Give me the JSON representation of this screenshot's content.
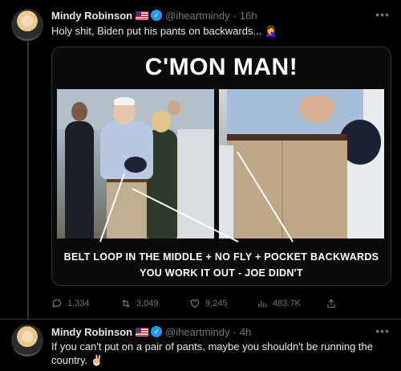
{
  "tweets": [
    {
      "author_name": "Mindy Robinson",
      "handle": "@iheartmindy",
      "time": "16h",
      "text": "Holy shit, Biden put his pants on backwards... ",
      "emoji": "🤦‍♀️",
      "media": {
        "headline": "C'MON MAN!",
        "caption_line1": "BELT LOOP IN THE MIDDLE + NO FLY + POCKET BACKWARDS",
        "caption_line2": "YOU WORK IT OUT - JOE DIDN'T"
      },
      "actions": {
        "replies": "1,334",
        "retweets": "3,049",
        "likes": "9,245",
        "views": "483.7K"
      }
    },
    {
      "author_name": "Mindy Robinson",
      "handle": "@iheartmindy",
      "time": "4h",
      "text": "If you can't put on a pair of pants, maybe you shouldn't be running the country. ",
      "emoji": "✌🏻"
    }
  ],
  "icons": {
    "verified": "verified-badge-icon",
    "flag": "us-flag-icon",
    "more": "more-icon",
    "reply": "reply-icon",
    "retweet": "retweet-icon",
    "like": "heart-icon",
    "views": "views-icon",
    "share": "share-icon"
  },
  "colors": {
    "background": "#000000",
    "text": "#e7e9ea",
    "muted": "#71767b",
    "verified": "#1d9bf0",
    "divider": "#2f3336"
  }
}
